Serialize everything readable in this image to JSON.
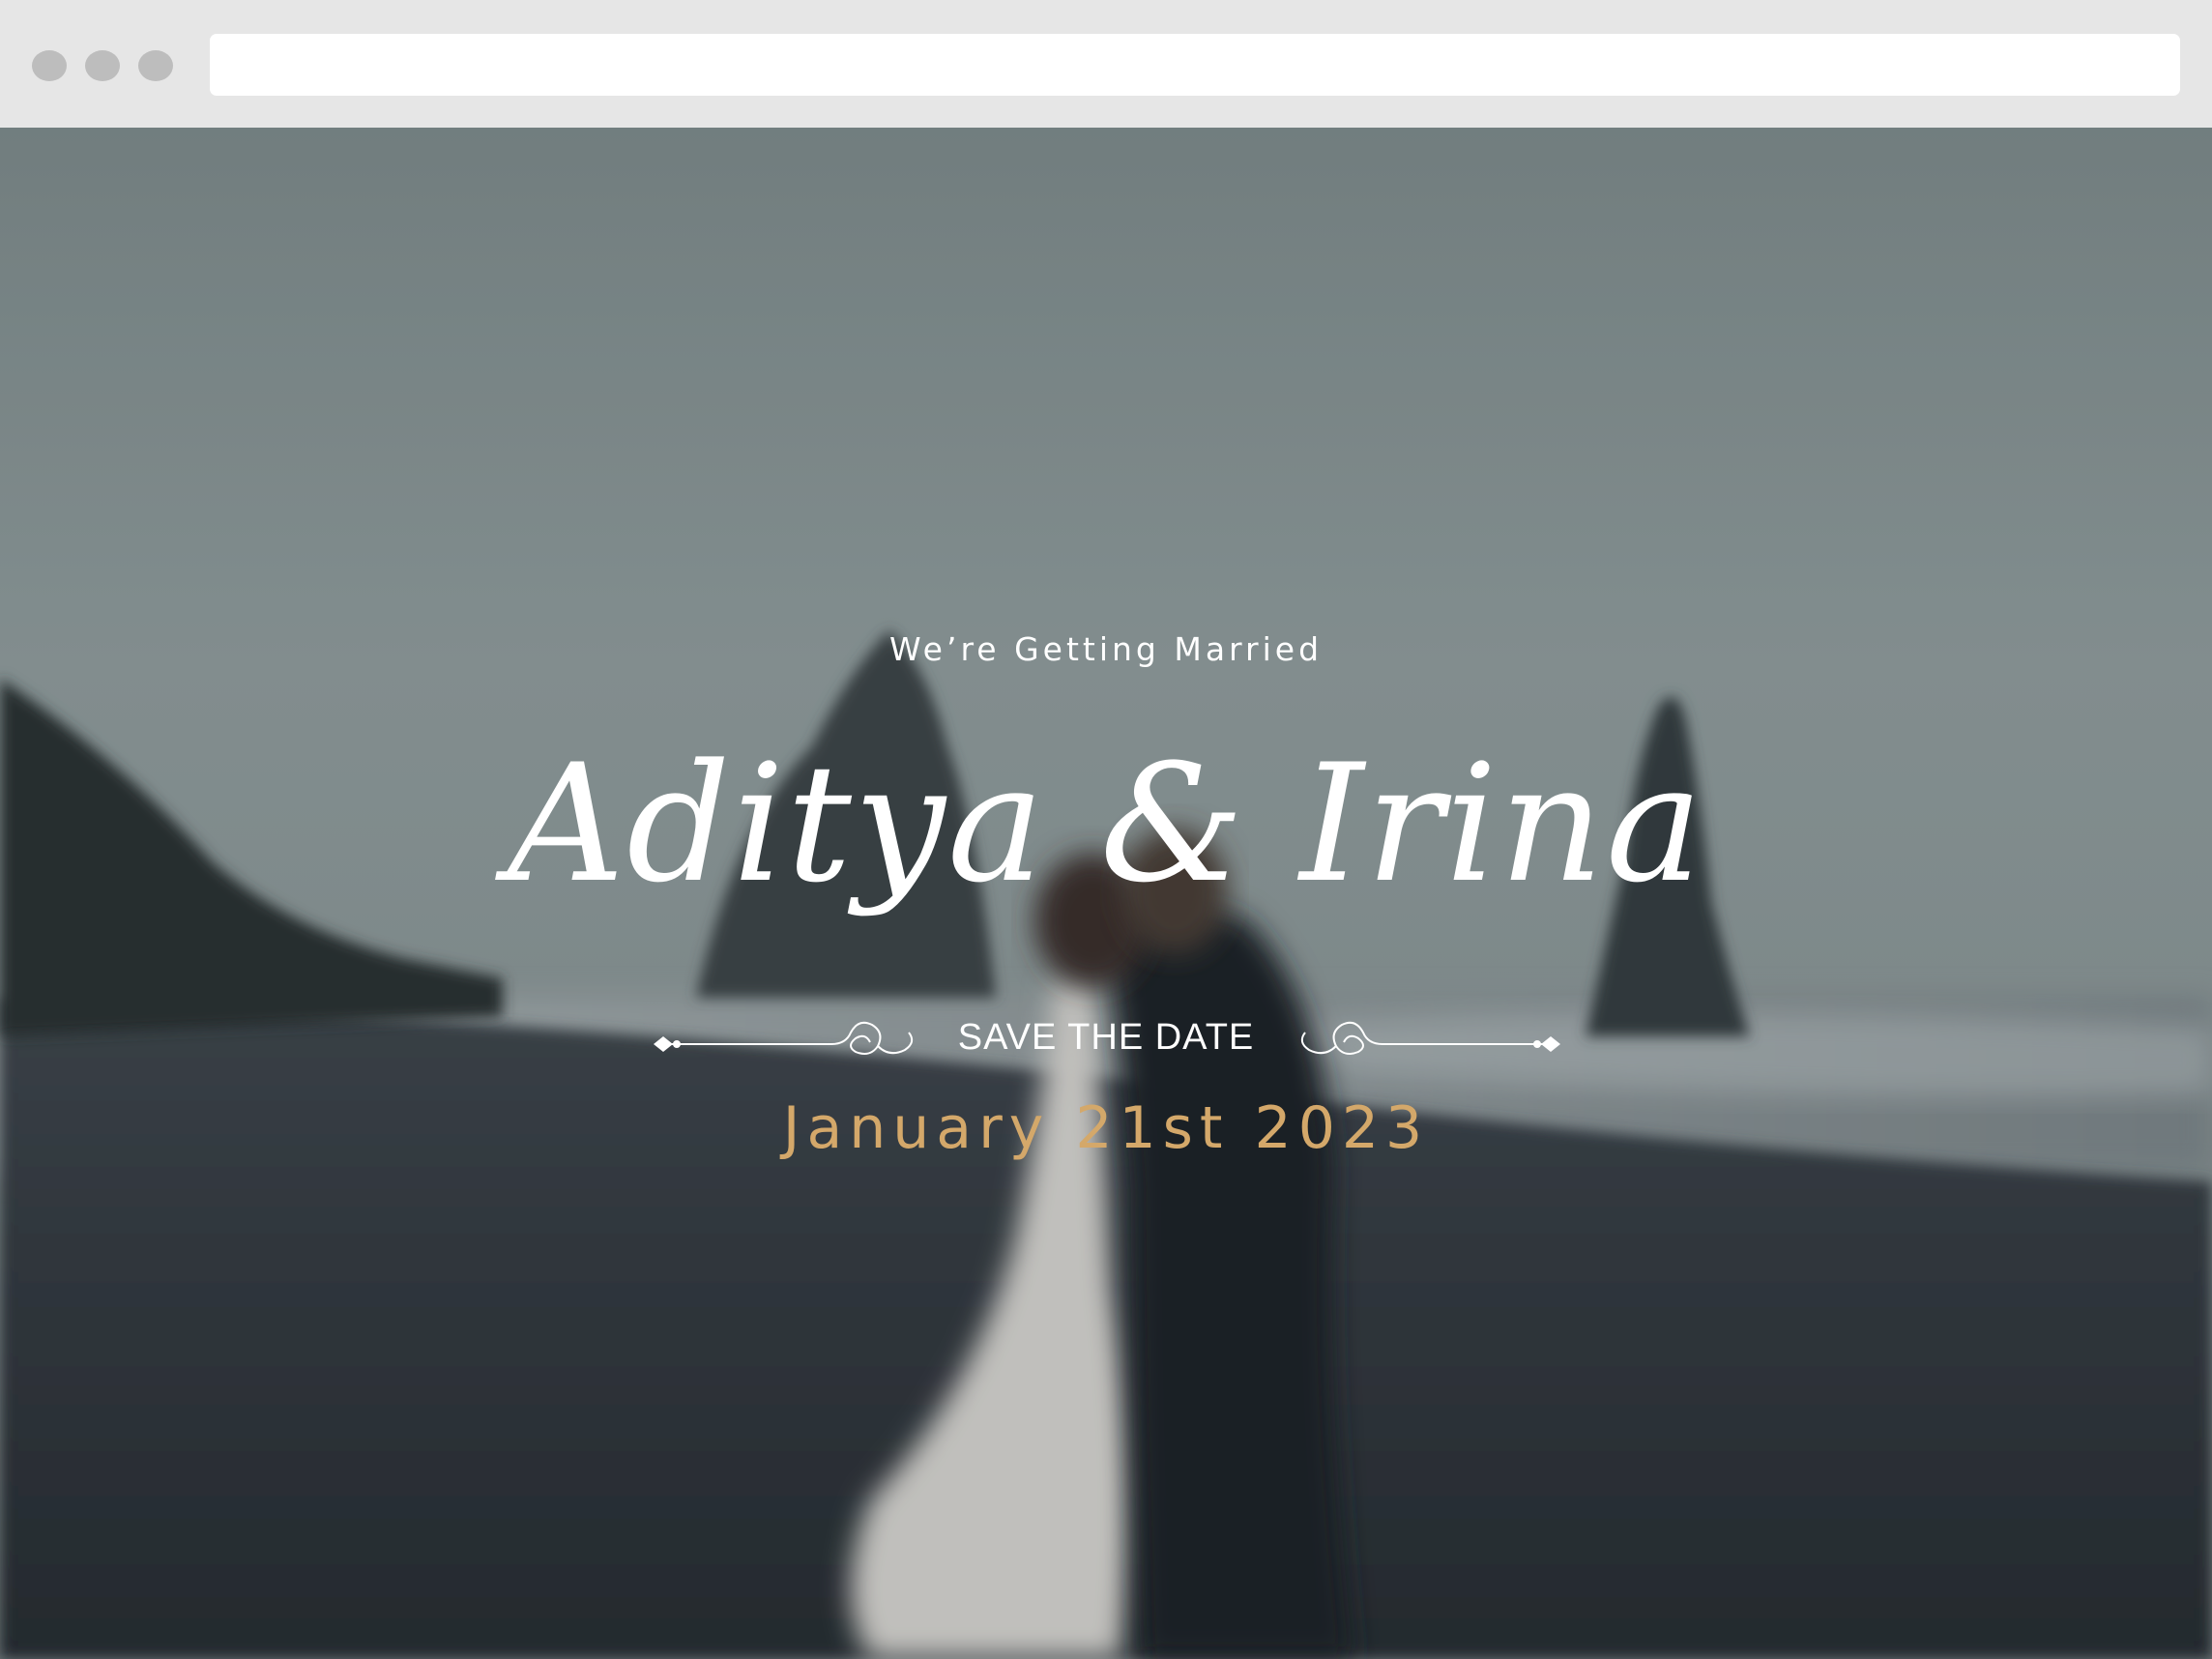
{
  "hero": {
    "eyebrow": "We’re Getting Married",
    "names": "Aditya & Irina",
    "save_the_date": "SAVE THE DATE",
    "date": "January 21st 2023"
  },
  "colors": {
    "accent": "#d4a86a",
    "text": "#ffffff",
    "chrome": "#e6e6e6"
  }
}
